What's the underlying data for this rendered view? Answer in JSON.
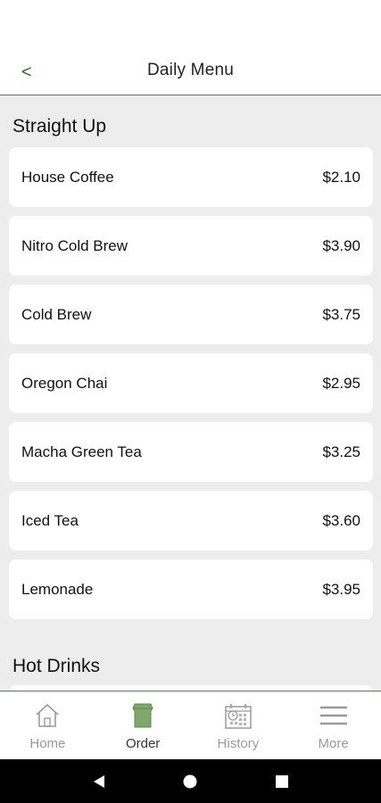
{
  "header": {
    "back_glyph": "<",
    "title": "Daily Menu"
  },
  "sections": [
    {
      "title": "Straight Up",
      "items": [
        {
          "name": "House Coffee",
          "price": "$2.10"
        },
        {
          "name": "Nitro Cold Brew",
          "price": "$3.90"
        },
        {
          "name": "Cold Brew",
          "price": "$3.75"
        },
        {
          "name": "Oregon Chai",
          "price": "$2.95"
        },
        {
          "name": "Macha Green Tea",
          "price": "$3.25"
        },
        {
          "name": "Iced Tea",
          "price": "$3.60"
        },
        {
          "name": "Lemonade",
          "price": "$3.95"
        }
      ]
    },
    {
      "title": "Hot Drinks",
      "items": []
    }
  ],
  "bottom_nav": {
    "items": [
      {
        "label": "Home",
        "icon": "home-icon"
      },
      {
        "label": "Order",
        "icon": "order-bag-icon",
        "active": true
      },
      {
        "label": "History",
        "icon": "history-calendar-icon"
      },
      {
        "label": "More",
        "icon": "menu-icon"
      }
    ]
  },
  "colors": {
    "accent_green": "#2f6b2a",
    "order_icon_green": "#7fa86b",
    "inactive_gray": "#9a9a9a",
    "background": "#ededed"
  }
}
